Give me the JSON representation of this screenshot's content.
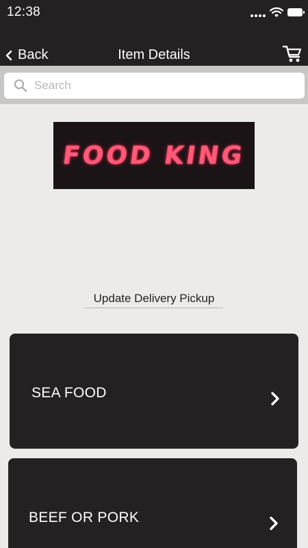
{
  "status_bar": {
    "time": "12:38"
  },
  "nav": {
    "back_label": "Back",
    "title": "Item Details"
  },
  "search": {
    "placeholder": "Search"
  },
  "restaurant": {
    "logo_text": "FOOD KING"
  },
  "update_link": "Update Delivery Pickup",
  "categories": [
    {
      "label": "SEA FOOD"
    },
    {
      "label": "BEEF OR PORK"
    }
  ],
  "colors": {
    "bar": "#232122",
    "page_bg": "#ecebe9",
    "logo_text": "#ff5a78"
  },
  "icons": [
    "signal-icon",
    "wifi-icon",
    "battery-icon",
    "chevron-left-icon",
    "cart-icon",
    "search-icon",
    "chevron-right-icon"
  ]
}
